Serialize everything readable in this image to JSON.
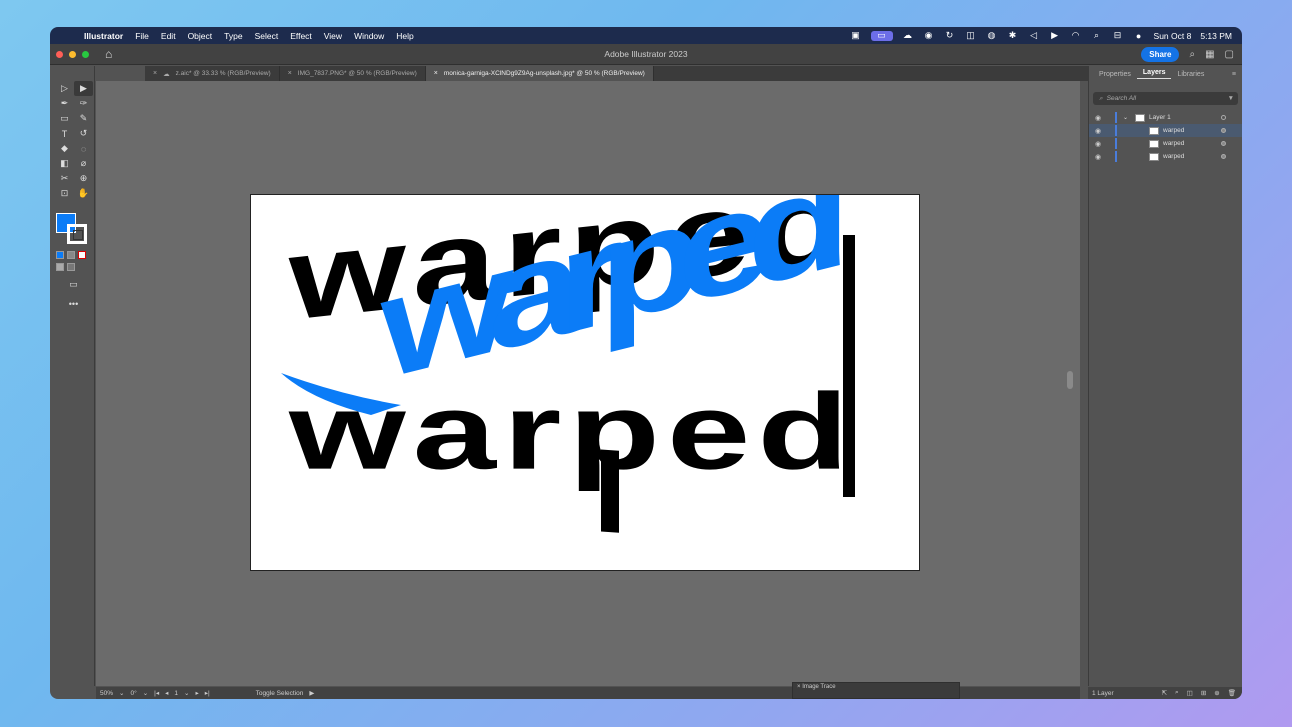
{
  "menubar": {
    "app": "Illustrator",
    "items": [
      "File",
      "Edit",
      "Object",
      "Type",
      "Select",
      "Effect",
      "View",
      "Window",
      "Help"
    ],
    "date": "Sun Oct 8",
    "time": "5:13 PM"
  },
  "window": {
    "title": "Adobe Illustrator 2023",
    "share_label": "Share"
  },
  "tabs": [
    {
      "label": "z.aic* @ 33.33 % (RGB/Preview)",
      "active": false
    },
    {
      "label": "IMG_7837.PNG* @ 50 % (RGB/Preview)",
      "active": false
    },
    {
      "label": "monica-garniga-XClNDg9Z9Ag-unsplash.jpg* @ 50 % (RGB/Preview)",
      "active": true
    }
  ],
  "panel": {
    "tabs": [
      "Properties",
      "Layers",
      "Libraries"
    ],
    "active_tab": "Layers",
    "search_placeholder": "Search All",
    "layer_name": "Layer 1",
    "sublayers": [
      "warped",
      "warped",
      "warped"
    ],
    "footer": "1 Layer"
  },
  "status": {
    "zoom": "50%",
    "rotation": "0°",
    "artboard": "1",
    "selection_tool": "Toggle Selection"
  },
  "trace_panel": {
    "title": "Image Trace"
  },
  "artwork": {
    "word": "warped",
    "fill_color": "#0b7cf7",
    "text_color": "#000000"
  },
  "colors": {
    "accent": "#1473e6",
    "fill": "#0b7cf7"
  }
}
